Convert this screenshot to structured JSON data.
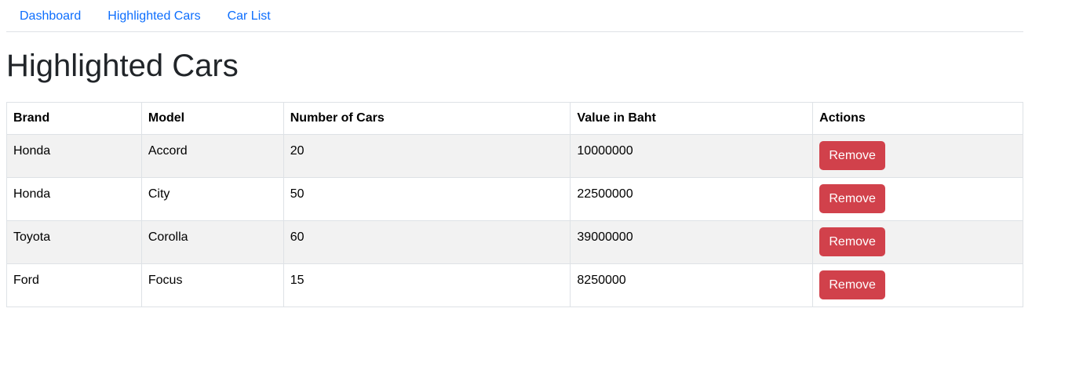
{
  "nav": {
    "items": [
      {
        "label": "Dashboard"
      },
      {
        "label": "Highlighted Cars"
      },
      {
        "label": "Car List"
      }
    ]
  },
  "page": {
    "title": "Highlighted Cars"
  },
  "table": {
    "headers": [
      "Brand",
      "Model",
      "Number of Cars",
      "Value in Baht",
      "Actions"
    ],
    "rows": [
      {
        "brand": "Honda",
        "model": "Accord",
        "count": "20",
        "value": "10000000",
        "action": "Remove"
      },
      {
        "brand": "Honda",
        "model": "City",
        "count": "50",
        "value": "22500000",
        "action": "Remove"
      },
      {
        "brand": "Toyota",
        "model": "Corolla",
        "count": "60",
        "value": "39000000",
        "action": "Remove"
      },
      {
        "brand": "Ford",
        "model": "Focus",
        "count": "15",
        "value": "8250000",
        "action": "Remove"
      }
    ]
  },
  "colors": {
    "link": "#0d6efd",
    "danger": "#d1414b",
    "stripe": "#f2f2f2"
  }
}
